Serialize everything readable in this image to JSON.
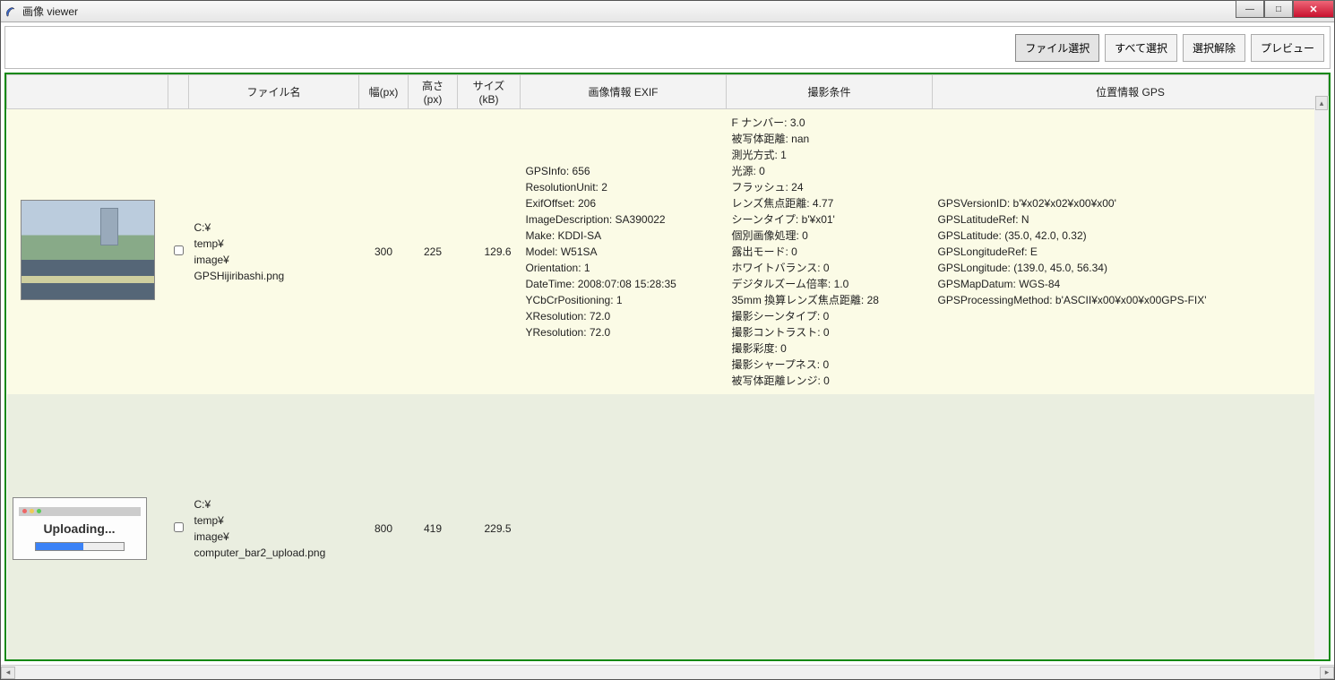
{
  "window": {
    "title": "画像 viewer"
  },
  "toolbar": {
    "file_select": "ファイル選択",
    "select_all": "すべて選択",
    "deselect": "選択解除",
    "preview": "プレビュー"
  },
  "headers": {
    "thumb": "",
    "check": "",
    "filename": "ファイル名",
    "width": "幅(px)",
    "height": "高さ(px)",
    "size": "サイズ(kB)",
    "exif": "画像情報 EXIF",
    "cond": "撮影条件",
    "gps": "位置情報 GPS"
  },
  "rows": [
    {
      "thumb_kind": "photo",
      "filename": "C:¥\ntemp¥\nimage¥\nGPSHijiribashi.png",
      "width": "300",
      "height": "225",
      "size": "129.6",
      "exif": "GPSInfo: 656\nResolutionUnit: 2\nExifOffset: 206\nImageDescription: SA390022\nMake: KDDI-SA\nModel: W51SA\nOrientation: 1\nDateTime: 2008:07:08 15:28:35\nYCbCrPositioning: 1\nXResolution: 72.0\nYResolution: 72.0",
      "cond": "F ナンバー: 3.0\n被写体距離: nan\n測光方式: 1\n光源: 0\nフラッシュ: 24\nレンズ焦点距離: 4.77\nシーンタイプ: b'¥x01'\n個別画像処理: 0\n露出モード: 0\nホワイトバランス: 0\nデジタルズーム倍率: 1.0\n35mm 換算レンズ焦点距離: 28\n撮影シーンタイプ: 0\n撮影コントラスト: 0\n撮影彩度: 0\n撮影シャープネス: 0\n被写体距離レンジ: 0",
      "gps": "GPSVersionID: b'¥x02¥x02¥x00¥x00'\nGPSLatitudeRef: N\nGPSLatitude: (35.0, 42.0, 0.32)\nGPSLongitudeRef: E\nGPSLongitude: (139.0, 45.0, 56.34)\nGPSMapDatum: WGS-84\nGPSProcessingMethod: b'ASCII¥x00¥x00¥x00GPS-FIX'"
    },
    {
      "thumb_kind": "upload",
      "upload_text": "Uploading...",
      "filename": "C:¥\ntemp¥\nimage¥\ncomputer_bar2_upload.png",
      "width": "800",
      "height": "419",
      "size": "229.5",
      "exif": "",
      "cond": "",
      "gps": ""
    }
  ]
}
